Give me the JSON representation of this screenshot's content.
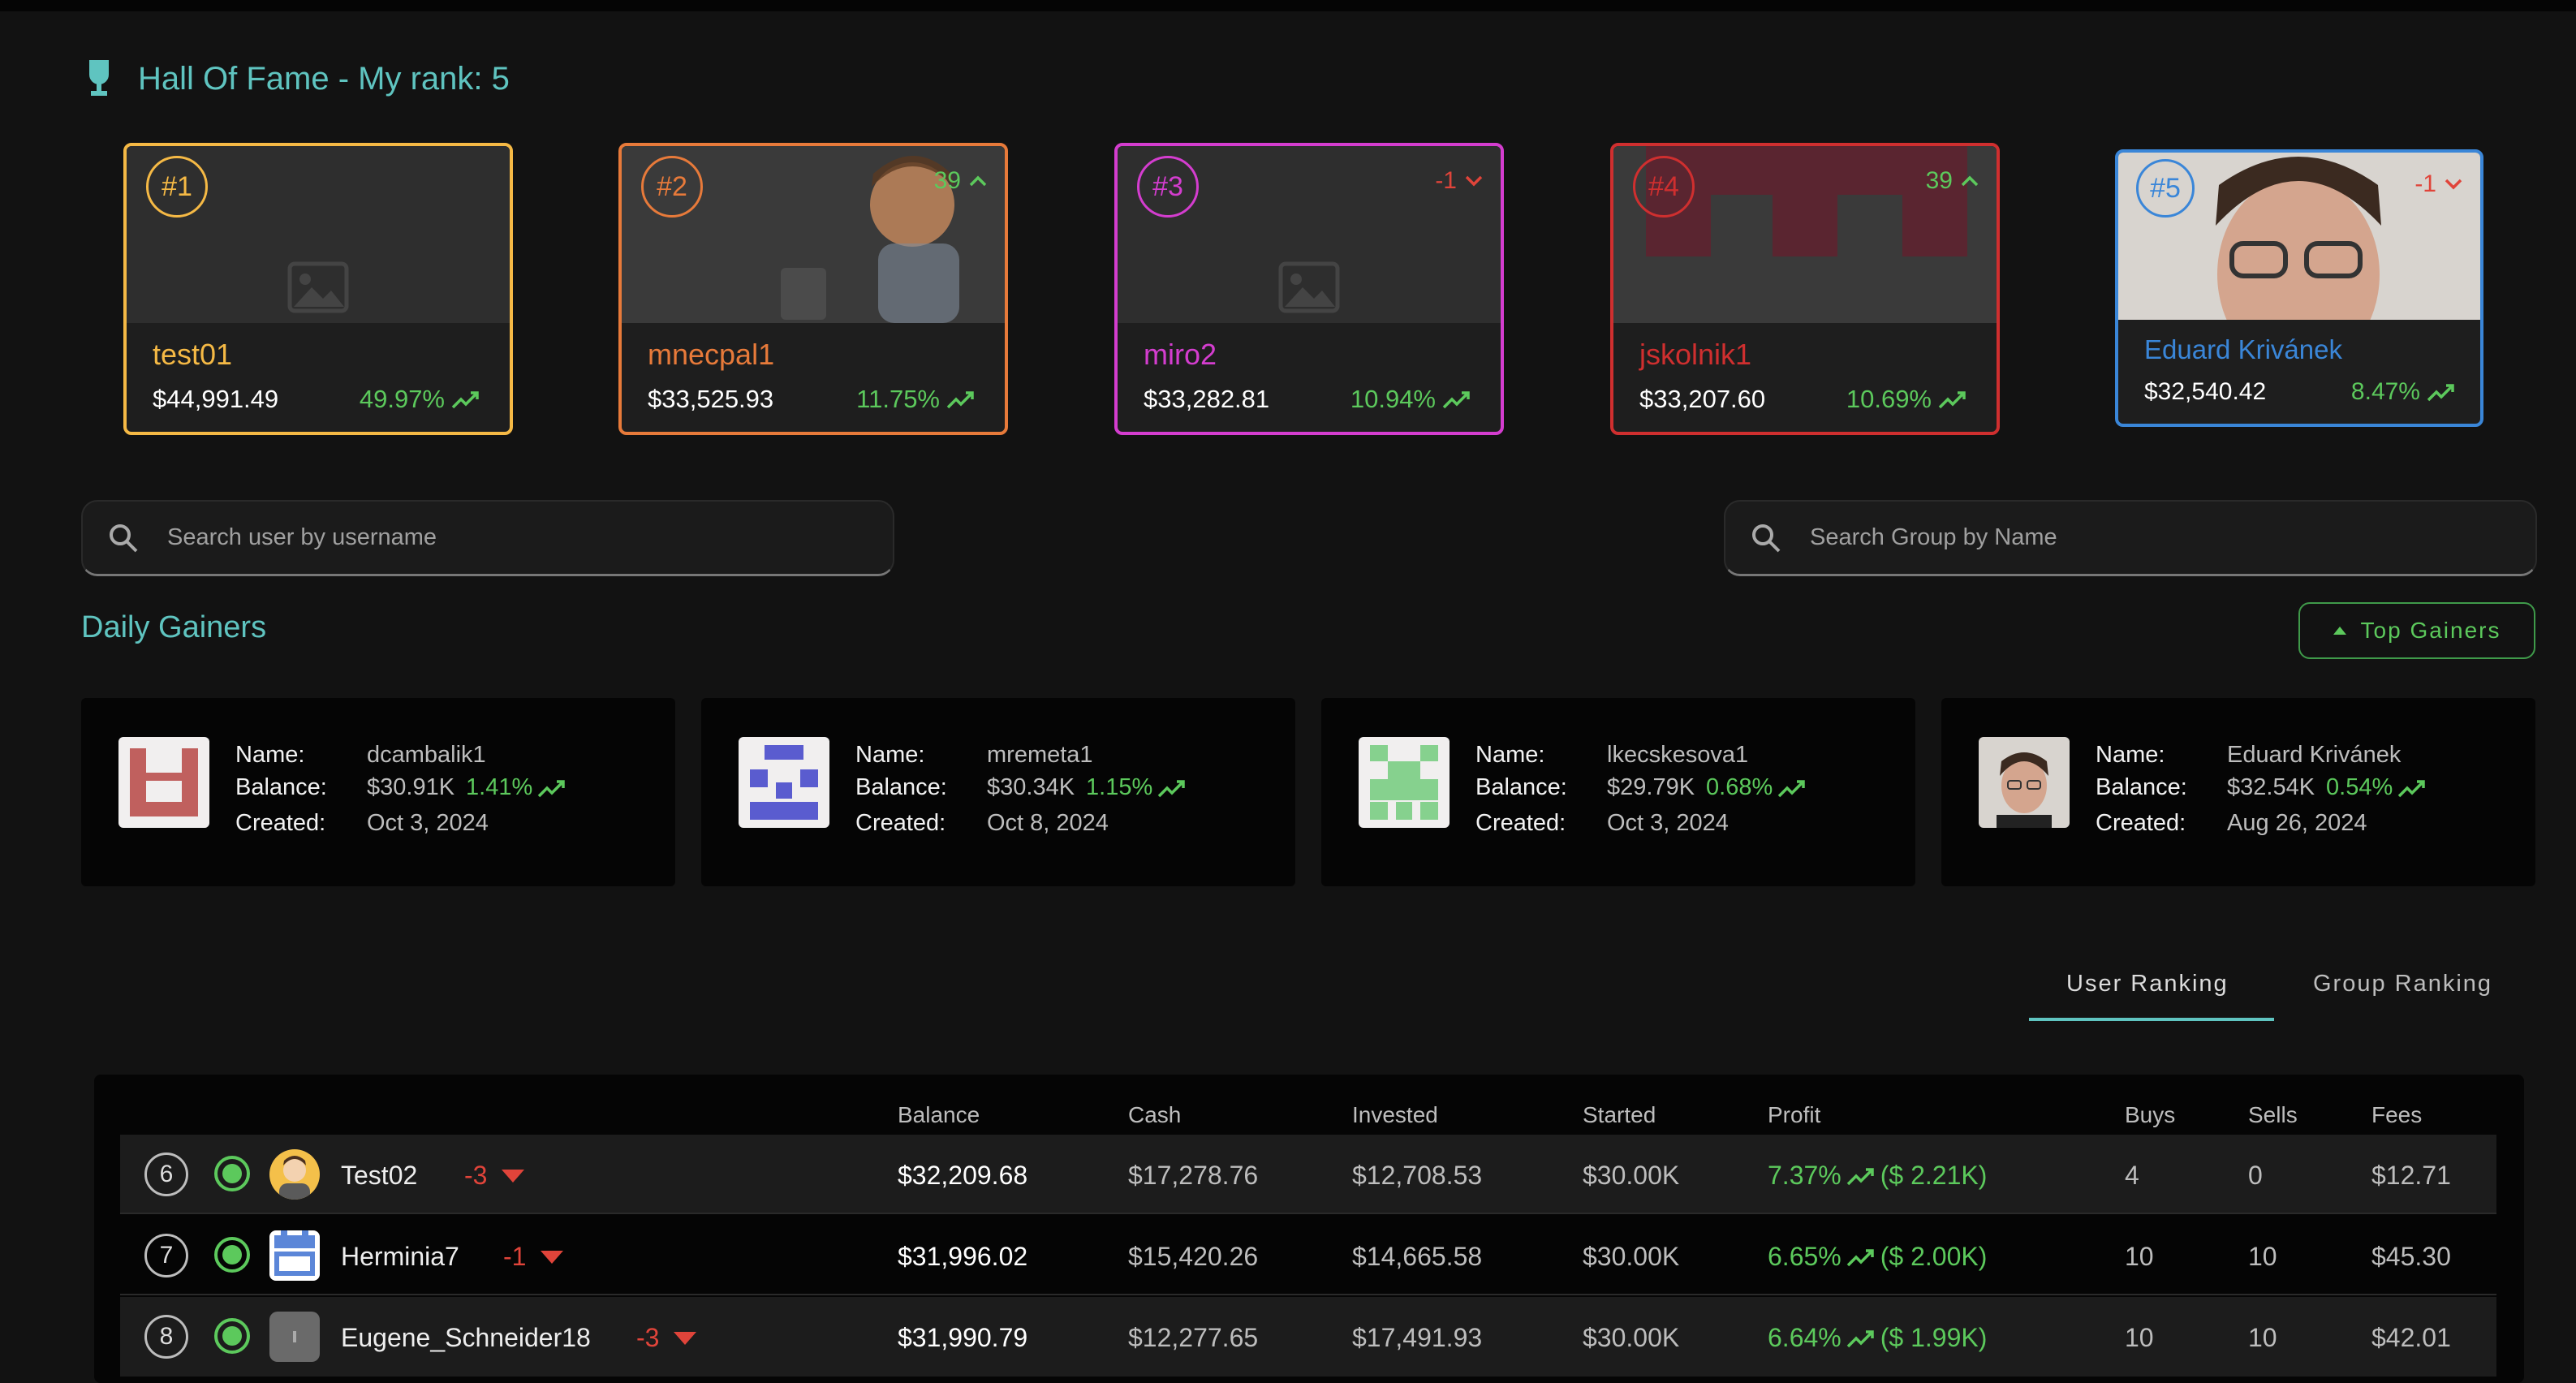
{
  "hall_of_fame": {
    "title": "Hall Of Fame - My rank: 5",
    "cards": [
      {
        "rank": "#1",
        "username": "test01",
        "balance": "$44,991.49",
        "percent": "49.97%",
        "change": "",
        "color": "#f5b945"
      },
      {
        "rank": "#2",
        "username": "mnecpal1",
        "balance": "$33,525.93",
        "percent": "11.75%",
        "change": "39",
        "change_dir": "up",
        "color": "#e77a3a"
      },
      {
        "rank": "#3",
        "username": "miro2",
        "balance": "$33,282.81",
        "percent": "10.94%",
        "change": "-1",
        "change_dir": "down",
        "color": "#d43dcf"
      },
      {
        "rank": "#4",
        "username": "jskolnik1",
        "balance": "$33,207.60",
        "percent": "10.69%",
        "change": "39",
        "change_dir": "up",
        "color": "#cf2f2f"
      },
      {
        "rank": "#5",
        "username": "Eduard Krivánek",
        "balance": "$32,540.42",
        "percent": "8.47%",
        "change": "-1",
        "change_dir": "down",
        "color": "#3a86d8"
      }
    ]
  },
  "search": {
    "user_placeholder": "Search user by username",
    "group_placeholder": "Search Group by Name"
  },
  "daily_gainers": {
    "title": "Daily Gainers",
    "top_gainers_label": "Top Gainers",
    "labels": {
      "name": "Name:",
      "balance": "Balance:",
      "created": "Created:"
    },
    "items": [
      {
        "name": "dcambalik1",
        "balance": "$30.91K",
        "percent": "1.41%",
        "created": "Oct 3, 2024"
      },
      {
        "name": "mremeta1",
        "balance": "$30.34K",
        "percent": "1.15%",
        "created": "Oct 8, 2024"
      },
      {
        "name": "lkecskesova1",
        "balance": "$29.79K",
        "percent": "0.68%",
        "created": "Oct 3, 2024"
      },
      {
        "name": "Eduard Krivánek",
        "balance": "$32.54K",
        "percent": "0.54%",
        "created": "Aug 26, 2024"
      }
    ]
  },
  "tabs": {
    "user_ranking": "User Ranking",
    "group_ranking": "Group Ranking"
  },
  "table": {
    "headers": {
      "balance": "Balance",
      "cash": "Cash",
      "invested": "Invested",
      "started": "Started",
      "profit": "Profit",
      "buys": "Buys",
      "sells": "Sells",
      "fees": "Fees"
    },
    "rows": [
      {
        "rank": "6",
        "name": "Test02",
        "change": "-3",
        "balance": "$32,209.68",
        "cash": "$17,278.76",
        "invested": "$12,708.53",
        "started": "$30.00K",
        "profit_pct": "7.37%",
        "profit_amt": "($ 2.21K)",
        "buys": "4",
        "sells": "0",
        "fees": "$12.71"
      },
      {
        "rank": "7",
        "name": "Herminia7",
        "change": "-1",
        "balance": "$31,996.02",
        "cash": "$15,420.26",
        "invested": "$14,665.58",
        "started": "$30.00K",
        "profit_pct": "6.65%",
        "profit_amt": "($ 2.00K)",
        "buys": "10",
        "sells": "10",
        "fees": "$45.30"
      },
      {
        "rank": "8",
        "name": "Eugene_Schneider18",
        "change": "-3",
        "balance": "$31,990.79",
        "cash": "$12,277.65",
        "invested": "$17,491.93",
        "started": "$30.00K",
        "profit_pct": "6.64%",
        "profit_amt": "($ 1.99K)",
        "buys": "10",
        "sells": "10",
        "fees": "$42.01"
      }
    ]
  },
  "icons": {
    "trophy": "trophy-icon",
    "search": "search-icon",
    "trend_up": "trending-up-icon",
    "arrow_up": "chevron-up-icon",
    "arrow_down": "chevron-down-icon",
    "online": "online-status-icon",
    "caret_down": "caret-down-icon",
    "caret_up": "caret-up-icon"
  }
}
